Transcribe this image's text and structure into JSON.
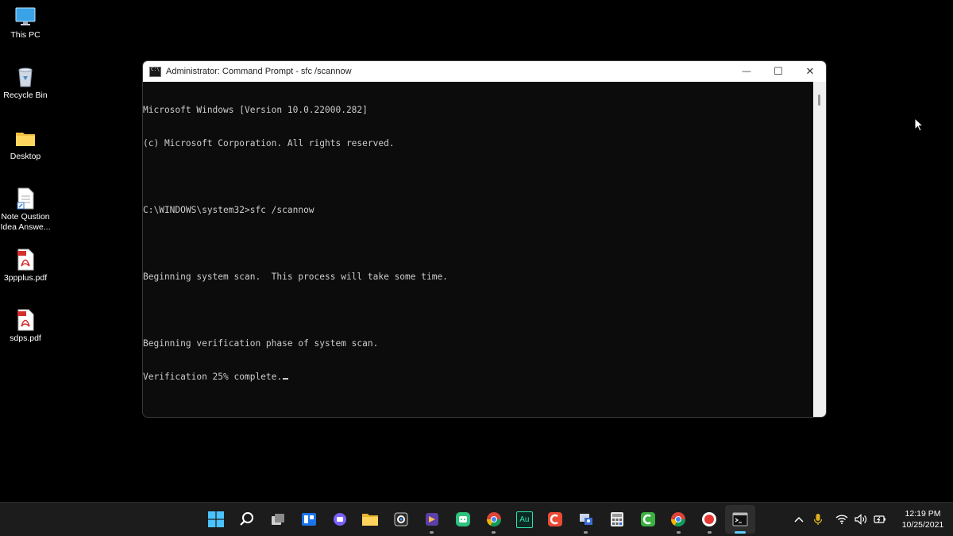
{
  "desktop": {
    "icons": [
      {
        "label": "This PC",
        "icon": "monitor-icon"
      },
      {
        "label": "Recycle Bin",
        "icon": "recycle-bin-icon"
      },
      {
        "label": "Desktop",
        "icon": "folder-icon"
      },
      {
        "label": "Note Qustion\nIdea Answe...",
        "icon": "document-shortcut-icon"
      },
      {
        "label": "3ppplus.pdf",
        "icon": "pdf-icon"
      },
      {
        "label": "sdps.pdf",
        "icon": "pdf-icon"
      }
    ]
  },
  "window": {
    "title": "Administrator: Command Prompt - sfc  /scannow",
    "controls": {
      "minimize": "—",
      "maximize": "☐",
      "close": "✕"
    },
    "console_lines": [
      "Microsoft Windows [Version 10.0.22000.282]",
      "(c) Microsoft Corporation. All rights reserved.",
      "",
      "C:\\WINDOWS\\system32>sfc /scannow",
      "",
      "Beginning system scan.  This process will take some time.",
      "",
      "Beginning verification phase of system scan.",
      "Verification 25% complete."
    ]
  },
  "taskbar": {
    "apps": [
      {
        "name": "start-button",
        "icon": "windows-logo-icon",
        "running": false
      },
      {
        "name": "search-button",
        "icon": "search-icon",
        "running": false
      },
      {
        "name": "task-view-button",
        "icon": "task-view-icon",
        "running": false
      },
      {
        "name": "widgets-button",
        "icon": "widgets-icon",
        "running": false
      },
      {
        "name": "chat-button",
        "icon": "chat-icon",
        "running": false
      },
      {
        "name": "file-explorer-button",
        "icon": "folder-icon",
        "running": false
      },
      {
        "name": "photo-app-button",
        "icon": "camera-app-icon",
        "running": false
      },
      {
        "name": "media-app-button",
        "icon": "media-app-icon",
        "running": true
      },
      {
        "name": "green-app-button",
        "icon": "green-app-icon",
        "running": false
      },
      {
        "name": "chrome-profile-button",
        "icon": "chrome-icon",
        "running": true
      },
      {
        "name": "audition-button",
        "icon": "audition-icon",
        "running": false,
        "text": "Au"
      },
      {
        "name": "camtasia-button",
        "icon": "camtasia-icon",
        "running": false
      },
      {
        "name": "network-tool-button",
        "icon": "network-tool-icon",
        "running": true
      },
      {
        "name": "calculator-button",
        "icon": "calculator-icon",
        "running": false
      },
      {
        "name": "camtasia-green-button",
        "icon": "camtasia-green-icon",
        "running": false
      },
      {
        "name": "chrome-button",
        "icon": "chrome-icon",
        "running": true
      },
      {
        "name": "recorder-button",
        "icon": "record-icon",
        "running": true
      },
      {
        "name": "terminal-button",
        "icon": "terminal-icon",
        "running": true,
        "active": true
      }
    ],
    "tray": {
      "time": "12:19 PM",
      "date": "10/25/2021"
    }
  },
  "colors": {
    "console_bg": "#0c0c0c",
    "console_text": "#cccccc",
    "taskbar_bg": "#1c1c1c",
    "accent": "#60cdff"
  }
}
